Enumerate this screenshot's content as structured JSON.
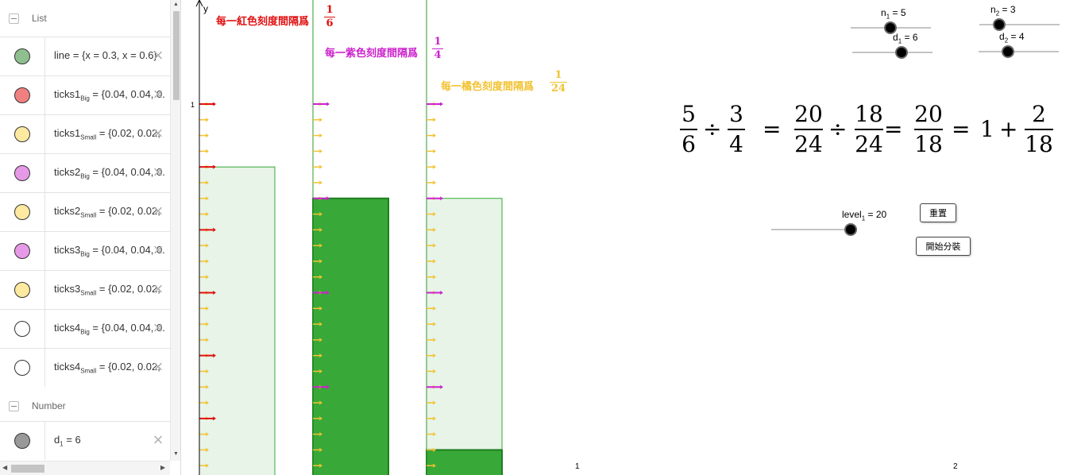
{
  "algebra": {
    "groups": {
      "list": "List",
      "number": "Number"
    },
    "rows": [
      {
        "name": "line",
        "sub": "",
        "value": "= {x = 0.3, x = 0.6}",
        "color": "#8fbf8f"
      },
      {
        "name": "ticks1",
        "sub": "Big",
        "value": "= {0.04, 0.04, 0.",
        "color": "#f08080"
      },
      {
        "name": "ticks1",
        "sub": "Small",
        "value": "= {0.02, 0.02,",
        "color": "#fde9a0"
      },
      {
        "name": "ticks2",
        "sub": "Big",
        "value": "= {0.04, 0.04, 0.",
        "color": "#e699e6"
      },
      {
        "name": "ticks2",
        "sub": "Small",
        "value": "= {0.02, 0.02,",
        "color": "#fde9a0"
      },
      {
        "name": "ticks3",
        "sub": "Big",
        "value": "= {0.04, 0.04, 0.",
        "color": "#e699e6"
      },
      {
        "name": "ticks3",
        "sub": "Small",
        "value": "= {0.02, 0.02,",
        "color": "#fde9a0"
      },
      {
        "name": "ticks4",
        "sub": "Big",
        "value": "= {0.04, 0.04, 0.",
        "color": "#ffffff"
      },
      {
        "name": "ticks4",
        "sub": "Small",
        "value": "= {0.02, 0.02,",
        "color": "#ffffff"
      }
    ],
    "number_rows": [
      {
        "name": "d",
        "sub": "1",
        "value": "= 6",
        "color": "#999999"
      }
    ]
  },
  "graphics": {
    "axis": {
      "y_label": "y",
      "tick_1": "1",
      "x_tick_1": "1",
      "x_tick_2": "2"
    },
    "labels": {
      "red": {
        "text": "每一紅色刻度間隔爲",
        "num": "1",
        "den": "6",
        "color": "#e01010"
      },
      "purple": {
        "text": "每一紫色刻度間隔爲",
        "num": "1",
        "den": "4",
        "color": "#cc22cc"
      },
      "orange": {
        "text": "每一橘色刻度間隔爲",
        "num": "1",
        "den": "24",
        "color": "#f2c230"
      }
    },
    "sliders": {
      "n1": {
        "name": "n",
        "sub": "1",
        "value": "= 5"
      },
      "d1": {
        "name": "d",
        "sub": "1",
        "value": "= 6"
      },
      "n2": {
        "name": "n",
        "sub": "2",
        "value": "= 3"
      },
      "d2": {
        "name": "d",
        "sub": "2",
        "value": "= 4"
      },
      "level1": {
        "name": "level",
        "sub": "1",
        "value": "= 20"
      }
    },
    "buttons": {
      "reset": "重置",
      "start": "開始分裝"
    },
    "equation": {
      "f1": {
        "num": "5",
        "den": "6"
      },
      "div1": "÷",
      "f2": {
        "num": "3",
        "den": "4"
      },
      "eq1": "=",
      "f3": {
        "num": "20",
        "den": "24"
      },
      "div2": "÷",
      "f4": {
        "num": "18",
        "den": "24"
      },
      "eq2": "=",
      "f5": {
        "num": "20",
        "den": "18"
      },
      "eq3": "=",
      "one": "1",
      "plus": "+",
      "f6": {
        "num": "2",
        "den": "18"
      }
    },
    "bars": {
      "bar1_fill": 0.8333,
      "bar2_fill": 0.75,
      "bar3_fill": 0.0833,
      "bar3_outline": 0.75
    }
  }
}
